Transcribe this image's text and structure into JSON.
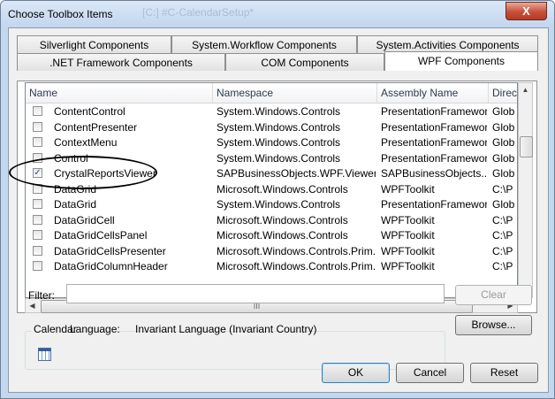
{
  "window": {
    "title": "Choose Toolbox Items",
    "title_ghost": "[C:] #C-CalendarSetup*",
    "close_glyph": "X"
  },
  "tabs": {
    "back_row": [
      "Silverlight Components",
      "System.Workflow Components",
      "System.Activities Components"
    ],
    "front_row": [
      ".NET Framework Components",
      "COM Components",
      "WPF Components"
    ],
    "active": "WPF Components"
  },
  "columns": [
    "Name",
    "Namespace",
    "Assembly Name",
    "Direc"
  ],
  "rows": [
    {
      "checked": false,
      "name": "ContentControl",
      "namespace": "System.Windows.Controls",
      "assembly": "PresentationFramework",
      "dir": "Glob"
    },
    {
      "checked": false,
      "name": "ContentPresenter",
      "namespace": "System.Windows.Controls",
      "assembly": "PresentationFramework",
      "dir": "Glob"
    },
    {
      "checked": false,
      "name": "ContextMenu",
      "namespace": "System.Windows.Controls",
      "assembly": "PresentationFramework",
      "dir": "Glob"
    },
    {
      "checked": false,
      "name": "Control",
      "namespace": "System.Windows.Controls",
      "assembly": "PresentationFramework",
      "dir": "Glob"
    },
    {
      "checked": true,
      "name": "CrystalReportsViewer",
      "namespace": "SAPBusinessObjects.WPF.Viewer",
      "assembly": "SAPBusinessObjects....",
      "dir": "Glob"
    },
    {
      "checked": false,
      "name": "DataGrid",
      "namespace": "Microsoft.Windows.Controls",
      "assembly": "WPFToolkit",
      "dir": "C:\\P"
    },
    {
      "checked": false,
      "name": "DataGrid",
      "namespace": "System.Windows.Controls",
      "assembly": "PresentationFramework",
      "dir": "Glob"
    },
    {
      "checked": false,
      "name": "DataGridCell",
      "namespace": "Microsoft.Windows.Controls",
      "assembly": "WPFToolkit",
      "dir": "C:\\P"
    },
    {
      "checked": false,
      "name": "DataGridCellsPanel",
      "namespace": "Microsoft.Windows.Controls",
      "assembly": "WPFToolkit",
      "dir": "C:\\P"
    },
    {
      "checked": false,
      "name": "DataGridCellsPresenter",
      "namespace": "Microsoft.Windows.Controls.Prim...",
      "assembly": "WPFToolkit",
      "dir": "C:\\P"
    },
    {
      "checked": false,
      "name": "DataGridColumnHeader",
      "namespace": "Microsoft.Windows.Controls.Prim...",
      "assembly": "WPFToolkit",
      "dir": "C:\\P"
    }
  ],
  "check_glyph": "✓",
  "scroll": {
    "up": "▲",
    "down": "▼",
    "left": "◀",
    "right": "▶",
    "grip_v": "≡",
    "grip_h": "III"
  },
  "filter": {
    "label": "Filter:",
    "value": "",
    "clear_label": "Clear"
  },
  "details": {
    "group_title": "Calendar",
    "language_label": "Language:",
    "language_value": "Invariant Language (Invariant Country)",
    "browse_label": "Browse..."
  },
  "buttons": {
    "ok": "OK",
    "cancel": "Cancel",
    "reset": "Reset"
  },
  "colors": {
    "accent": "#3c7fb1",
    "close": "#c74f3a",
    "frame": "#c3d7ee"
  }
}
